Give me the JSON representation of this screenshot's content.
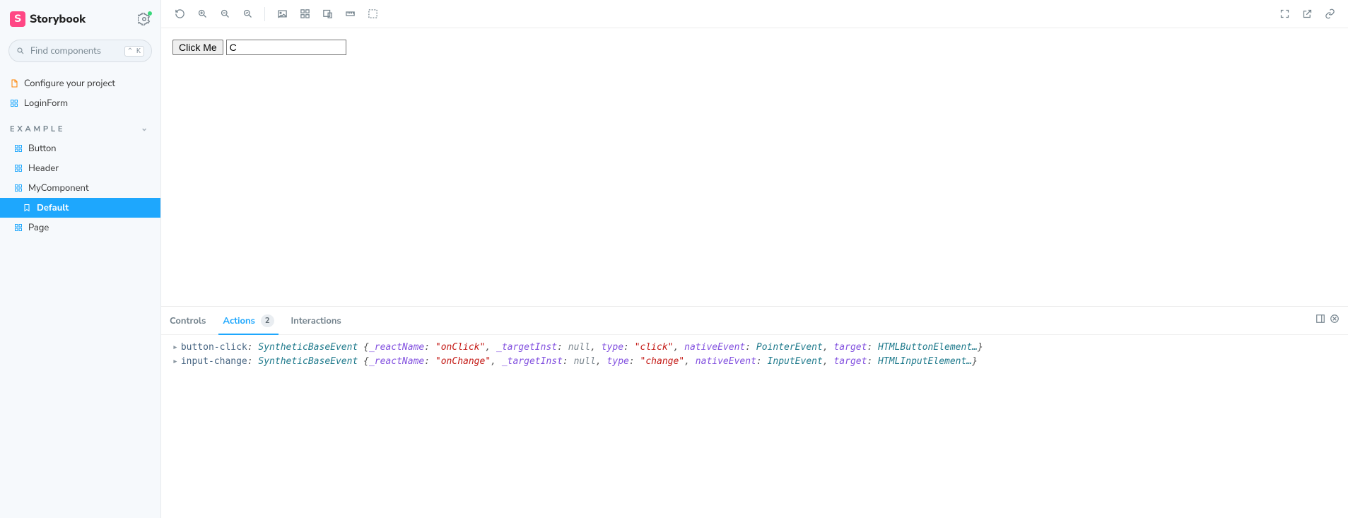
{
  "brand": "Storybook",
  "search_placeholder": "Find components",
  "search_shortcut": "^ K",
  "top_items": [
    {
      "icon": "document-icon",
      "label": "Configure your project",
      "kind": "doc"
    },
    {
      "icon": "component-icon",
      "label": "LoginForm",
      "kind": "comp"
    }
  ],
  "group_label": "EXAMPLE",
  "example_items": [
    {
      "label": "Button"
    },
    {
      "label": "Header"
    },
    {
      "label": "MyComponent",
      "expanded": true,
      "children": [
        {
          "label": "Default",
          "selected": true
        }
      ]
    },
    {
      "label": "Page"
    }
  ],
  "story": {
    "button_label": "Click Me",
    "input_value": "C"
  },
  "addon": {
    "tabs": {
      "controls": "Controls",
      "actions": "Actions",
      "actions_count": "2",
      "interactions": "Interactions"
    },
    "logs": [
      {
        "name": "button-click",
        "obj": "SyntheticBaseEvent",
        "parts": {
          "reactName": "onClick",
          "targetInst": "null",
          "type": "click",
          "nativeEvent": "PointerEvent",
          "target": "HTMLButtonElement…"
        }
      },
      {
        "name": "input-change",
        "obj": "SyntheticBaseEvent",
        "parts": {
          "reactName": "onChange",
          "targetInst": "null",
          "type": "change",
          "nativeEvent": "InputEvent",
          "target": "HTMLInputElement…"
        }
      }
    ]
  }
}
